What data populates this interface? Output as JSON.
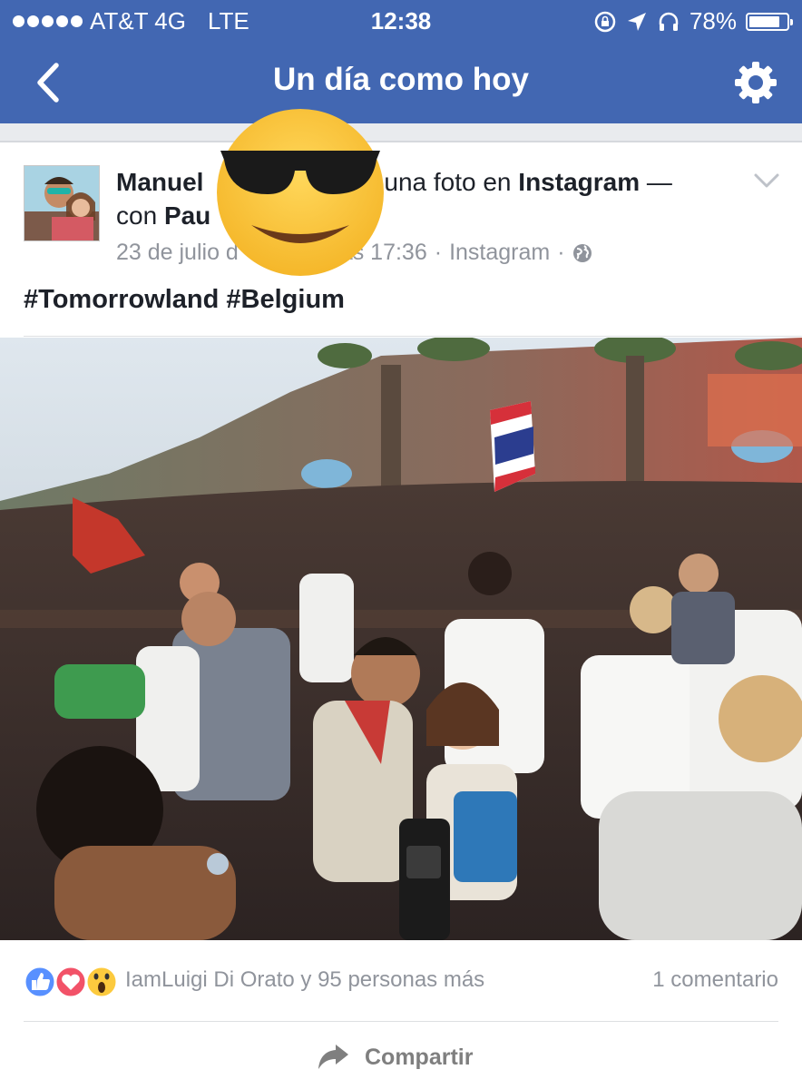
{
  "status_bar": {
    "carrier": "AT&T 4G",
    "network": "LTE",
    "time": "12:38",
    "battery": "78%",
    "battery_level": 0.78,
    "icons": [
      "signal-dots-icon",
      "rotation-lock-icon",
      "location-arrow-icon",
      "headphones-icon",
      "battery-icon"
    ]
  },
  "nav": {
    "title": "Un día como hoy",
    "back_icon": "chevron-left-icon",
    "settings_icon": "gear-icon"
  },
  "post": {
    "author_first": "Manuel",
    "action_fragment": "ó una foto en",
    "platform": "Instagram",
    "dash": "—",
    "with_label": "con",
    "with_name_fragment": "Pau",
    "date_fragment": "23 de julio d",
    "time_fragment": "as 17:36",
    "separator": "·",
    "source": "Instagram",
    "privacy_icon": "globe-icon",
    "text": "#Tomorrowland #Belgium",
    "menu_icon": "chevron-down-icon",
    "sticker": "sunglasses-emoji"
  },
  "footer": {
    "reaction_icons": [
      "like-icon",
      "love-icon",
      "wow-icon"
    ],
    "reactions_text": "IamLuigi Di Orato y 95 personas más",
    "comments_text": "1 comentario",
    "share_label": "Compartir",
    "share_icon": "share-arrow-icon"
  },
  "colors": {
    "brand_blue": "#4267b2",
    "secondary_text": "#90949c",
    "like_blue": "#5890ff",
    "love_red": "#f25268",
    "wow_yellow": "#fcca3e"
  }
}
